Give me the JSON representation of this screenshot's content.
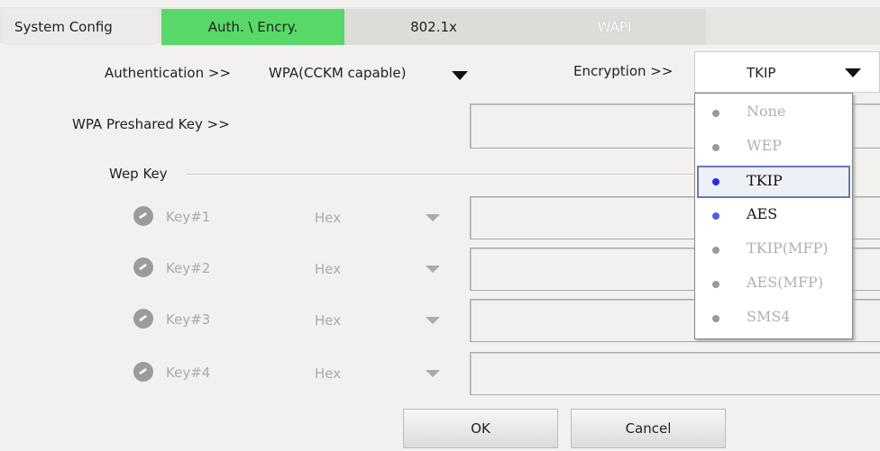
{
  "tabs": [
    {
      "label": "System Config"
    },
    {
      "label": "Auth. \\ Encry."
    },
    {
      "label": "802.1x"
    },
    {
      "label": "WAPI"
    }
  ],
  "authentication": {
    "label": "Authentication >>",
    "value": "WPA(CCKM capable)"
  },
  "encryption": {
    "label": "Encryption >>",
    "value": "TKIP",
    "options": [
      "None",
      "WEP",
      "TKIP",
      "AES",
      "TKIP(MFP)",
      "AES(MFP)",
      "SMS4"
    ]
  },
  "wpa_psk": {
    "label": "WPA Preshared Key >>",
    "value": ""
  },
  "wep": {
    "group_label": "Wep Key",
    "keys": [
      {
        "label": "Key#1",
        "format": "Hex",
        "value": ""
      },
      {
        "label": "Key#2",
        "format": "Hex",
        "value": ""
      },
      {
        "label": "Key#3",
        "format": "Hex",
        "value": ""
      },
      {
        "label": "Key#4",
        "format": "Hex",
        "value": ""
      }
    ]
  },
  "buttons": {
    "ok": "OK",
    "cancel": "Cancel"
  },
  "colors": {
    "active_tab": "#58d868",
    "selected_dot": "#2a2ad8"
  }
}
